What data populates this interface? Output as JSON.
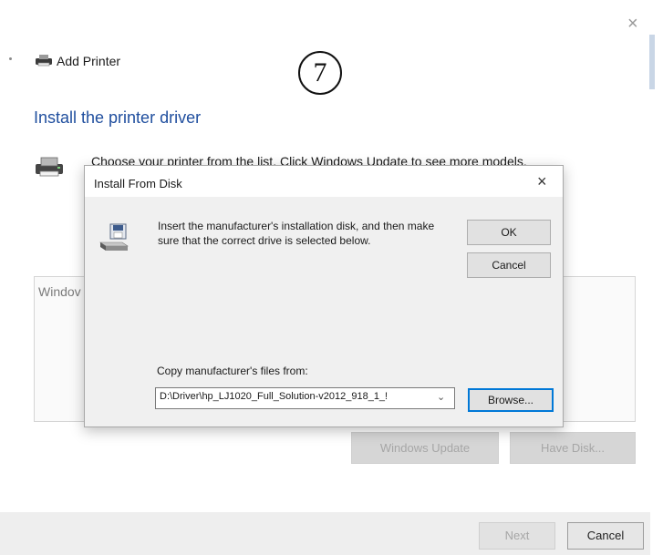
{
  "wizard": {
    "title": "Add Printer",
    "close_glyph": "×",
    "step_badge": "7",
    "heading": "Install the printer driver",
    "instruction": "Choose your printer from the list. Click Windows Update to see more models.",
    "list_item_partial": "Windov",
    "buttons": {
      "windows_update": "Windows Update",
      "have_disk": "Have Disk...",
      "next": "Next",
      "cancel": "Cancel"
    }
  },
  "dialog": {
    "title": "Install From Disk",
    "close_glyph": "×",
    "instructions": "Insert the manufacturer's installation disk, and then make sure that the correct drive is selected below.",
    "ok_label": "OK",
    "cancel_label": "Cancel",
    "copy_label": "Copy manufacturer's files from:",
    "path_value": "D:\\Driver\\hp_LJ1020_Full_Solution-v2012_918_1_!",
    "combo_arrow": "⌄",
    "browse_label": "Browse..."
  },
  "icons": [
    "printer-icon",
    "disk-drive-icon",
    "close-icon",
    "chevron-down-icon"
  ],
  "colors": {
    "heading": "#1f4e9e",
    "focus_border": "#0078d7",
    "disabled_text": "#a6a6a6"
  }
}
